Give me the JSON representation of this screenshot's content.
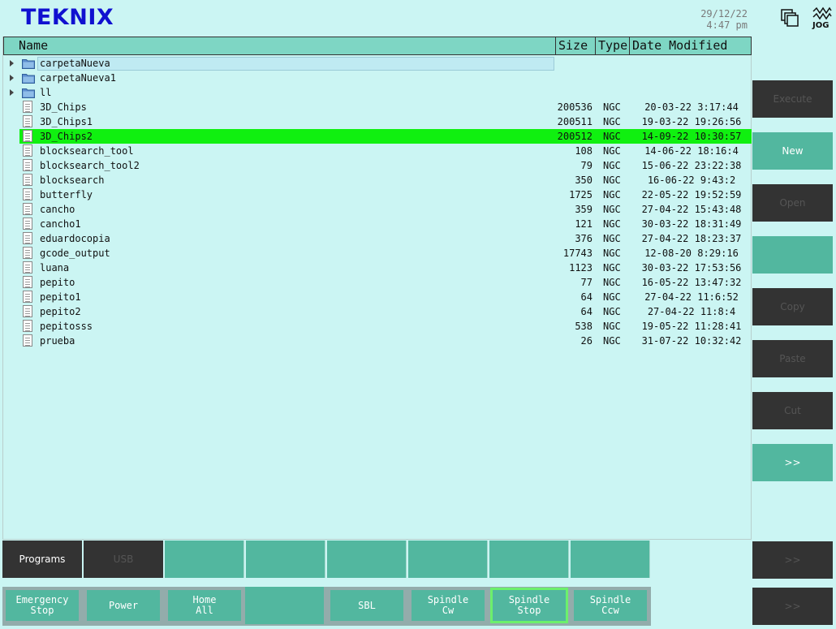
{
  "app": {
    "logo": "TEKNIX",
    "date": "29/12/22",
    "time": "4:47 pm",
    "jog_label": "JOG"
  },
  "file_table": {
    "columns": [
      "Name",
      "Size",
      "Type",
      "Date Modified"
    ],
    "rows": [
      {
        "kind": "folder",
        "name": "carpetaNueva",
        "size": "",
        "type": "",
        "date": "",
        "state": "focused"
      },
      {
        "kind": "folder",
        "name": "carpetaNueva1",
        "size": "",
        "type": "",
        "date": "",
        "state": ""
      },
      {
        "kind": "folder",
        "name": "ll",
        "size": "",
        "type": "",
        "date": "",
        "state": ""
      },
      {
        "kind": "file",
        "name": "3D_Chips",
        "size": "200536",
        "type": "NGC",
        "date": "20-03-22 3:17:44",
        "state": ""
      },
      {
        "kind": "file",
        "name": "3D_Chips1",
        "size": "200511",
        "type": "NGC",
        "date": "19-03-22 19:26:56",
        "state": ""
      },
      {
        "kind": "file",
        "name": "3D_Chips2",
        "size": "200512",
        "type": "NGC",
        "date": "14-09-22 10:30:57",
        "state": "selected"
      },
      {
        "kind": "file",
        "name": "blocksearch_tool",
        "size": "108",
        "type": "NGC",
        "date": "14-06-22 18:16:4",
        "state": ""
      },
      {
        "kind": "file",
        "name": "blocksearch_tool2",
        "size": "79",
        "type": "NGC",
        "date": "15-06-22 23:22:38",
        "state": ""
      },
      {
        "kind": "file",
        "name": "blocksearch",
        "size": "350",
        "type": "NGC",
        "date": "16-06-22 9:43:2",
        "state": ""
      },
      {
        "kind": "file",
        "name": "butterfly",
        "size": "1725",
        "type": "NGC",
        "date": "22-05-22 19:52:59",
        "state": ""
      },
      {
        "kind": "file",
        "name": "cancho",
        "size": "359",
        "type": "NGC",
        "date": "27-04-22 15:43:48",
        "state": ""
      },
      {
        "kind": "file",
        "name": "cancho1",
        "size": "121",
        "type": "NGC",
        "date": "30-03-22 18:31:49",
        "state": ""
      },
      {
        "kind": "file",
        "name": "eduardocopia",
        "size": "376",
        "type": "NGC",
        "date": "27-04-22 18:23:37",
        "state": ""
      },
      {
        "kind": "file",
        "name": "gcode_output",
        "size": "17743",
        "type": "NGC",
        "date": "12-08-20 8:29:16",
        "state": ""
      },
      {
        "kind": "file",
        "name": "luana",
        "size": "1123",
        "type": "NGC",
        "date": "30-03-22 17:53:56",
        "state": ""
      },
      {
        "kind": "file",
        "name": "pepito",
        "size": "77",
        "type": "NGC",
        "date": "16-05-22 13:47:32",
        "state": ""
      },
      {
        "kind": "file",
        "name": "pepito1",
        "size": "64",
        "type": "NGC",
        "date": "27-04-22 11:6:52",
        "state": ""
      },
      {
        "kind": "file",
        "name": "pepito2",
        "size": "64",
        "type": "NGC",
        "date": "27-04-22 11:8:4",
        "state": ""
      },
      {
        "kind": "file",
        "name": "pepitosss",
        "size": "538",
        "type": "NGC",
        "date": "19-05-22 11:28:41",
        "state": ""
      },
      {
        "kind": "file",
        "name": "prueba",
        "size": "26",
        "type": "NGC",
        "date": "31-07-22 10:32:42",
        "state": ""
      }
    ]
  },
  "side_buttons": [
    {
      "label": "Execute",
      "style": "dark"
    },
    {
      "label": "New",
      "style": "teal"
    },
    {
      "label": "Open",
      "style": "dark"
    },
    {
      "label": "",
      "style": "teal"
    },
    {
      "label": "Copy",
      "style": "dark"
    },
    {
      "label": "Paste",
      "style": "dark"
    },
    {
      "label": "Cut",
      "style": "dark"
    },
    {
      "label": ">>",
      "style": "teal"
    },
    {
      "label": ">>",
      "style": "dark"
    },
    {
      "label": ">>",
      "style": "dark"
    }
  ],
  "tabs": [
    {
      "label": "Programs",
      "style": "dark"
    },
    {
      "label": "USB",
      "style": "dark-disabled"
    },
    {
      "label": "",
      "style": "teal"
    },
    {
      "label": "",
      "style": "teal"
    },
    {
      "label": "",
      "style": "teal"
    },
    {
      "label": "",
      "style": "teal"
    },
    {
      "label": "",
      "style": "teal"
    },
    {
      "label": "",
      "style": "teal"
    }
  ],
  "bottom_buttons": [
    {
      "label": "Emergency\nStop"
    },
    {
      "label": "Power"
    },
    {
      "label": "Home\nAll"
    },
    {
      "label": ""
    },
    {
      "label": "SBL"
    },
    {
      "label": "Spindle\nCw"
    },
    {
      "label": "Spindle\nStop",
      "selected": true
    },
    {
      "label": "Spindle\nCcw"
    }
  ],
  "colors": {
    "background": "#cbf5f3",
    "header": "#7ed6c4",
    "teal_button": "#52b79f",
    "dark_button": "#333333",
    "selection": "#10f010",
    "logo": "#1010d0"
  }
}
